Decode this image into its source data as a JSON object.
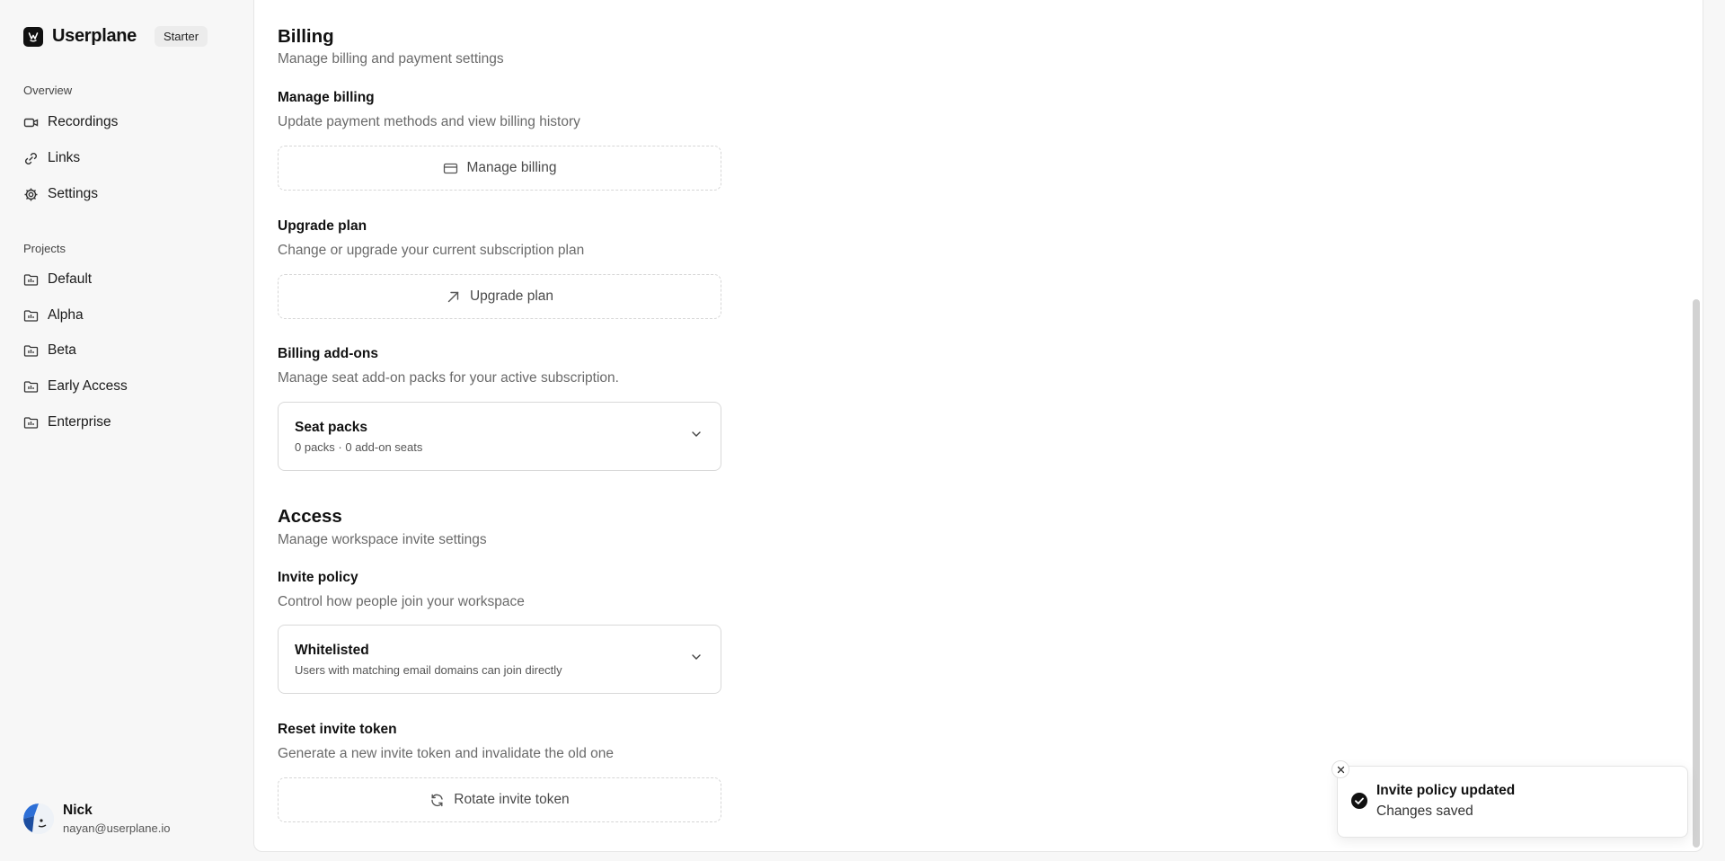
{
  "brand": {
    "name": "Userplane",
    "plan": "Starter"
  },
  "nav": {
    "overview_title": "Overview",
    "overview_items": [
      {
        "label": "Recordings",
        "icon": "video-icon"
      },
      {
        "label": "Links",
        "icon": "link-icon"
      },
      {
        "label": "Settings",
        "icon": "gear-icon"
      }
    ],
    "projects_title": "Projects",
    "projects": [
      {
        "label": "Default",
        "icon": "folder-icon"
      },
      {
        "label": "Alpha",
        "icon": "folder-icon"
      },
      {
        "label": "Beta",
        "icon": "folder-icon"
      },
      {
        "label": "Early Access",
        "icon": "folder-icon"
      },
      {
        "label": "Enterprise",
        "icon": "folder-icon"
      }
    ]
  },
  "user": {
    "name": "Nick",
    "email": "nayan@userplane.io"
  },
  "billing": {
    "title": "Billing",
    "description": "Manage billing and payment settings",
    "manage": {
      "label": "Manage billing",
      "description": "Update payment methods and view billing history",
      "button": "Manage billing"
    },
    "upgrade": {
      "label": "Upgrade plan",
      "description": "Change or upgrade your current subscription plan",
      "button": "Upgrade plan"
    },
    "addons": {
      "label": "Billing add-ons",
      "description": "Manage seat add-on packs for your active subscription.",
      "select_title": "Seat packs",
      "select_sub": "0 packs · 0 add-on seats"
    }
  },
  "access": {
    "title": "Access",
    "description": "Manage workspace invite settings",
    "invite_policy": {
      "label": "Invite policy",
      "description": "Control how people join your workspace",
      "select_title": "Whitelisted",
      "select_sub": "Users with matching email domains can join directly"
    },
    "reset_token": {
      "label": "Reset invite token",
      "description": "Generate a new invite token and invalidate the old one",
      "button": "Rotate invite token"
    }
  },
  "toast": {
    "title": "Invite policy updated",
    "message": "Changes saved"
  }
}
